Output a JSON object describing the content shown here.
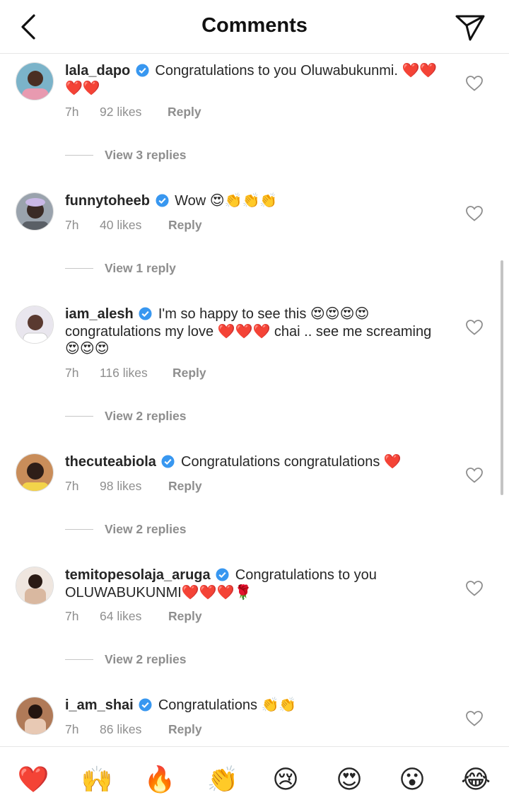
{
  "header": {
    "title": "Comments"
  },
  "comments": [
    {
      "username": "lala_dapo",
      "text": "Congratulations to you Oluwabukunmi. ❤️❤️❤️❤️",
      "time": "7h",
      "likes": "92 likes",
      "reply": "Reply",
      "view_replies": "View 3 replies"
    },
    {
      "username": "funnytoheeb",
      "text": "Wow 😍👏👏👏",
      "time": "7h",
      "likes": "40 likes",
      "reply": "Reply",
      "view_replies": "View 1 reply"
    },
    {
      "username": "iam_alesh",
      "text": "I'm so happy to see this 😍😍😍😍 congratulations my love ❤️❤️❤️ chai .. see me screaming 😍😍😍",
      "time": "7h",
      "likes": "116 likes",
      "reply": "Reply",
      "view_replies": "View 2 replies"
    },
    {
      "username": "thecuteabiola",
      "text": "Congratulations congratulations ❤️",
      "time": "7h",
      "likes": "98 likes",
      "reply": "Reply",
      "view_replies": "View 2 replies"
    },
    {
      "username": "temitopesolaja_aruga",
      "text": "Congratulations to you OLUWABUKUNMI❤️❤️❤️🌹",
      "time": "7h",
      "likes": "64 likes",
      "reply": "Reply",
      "view_replies": "View 2 replies"
    },
    {
      "username": "i_am_shai",
      "text": "Congratulations 👏👏",
      "time": "7h",
      "likes": "86 likes",
      "reply": "Reply"
    }
  ],
  "emoji_bar": [
    "❤️",
    "🙌",
    "🔥",
    "👏",
    "😢",
    "😍",
    "😮",
    "😂"
  ],
  "colors": {
    "verified": "#3897f0",
    "meta_text": "#8e8e8e",
    "divider": "#e6e6e6"
  }
}
